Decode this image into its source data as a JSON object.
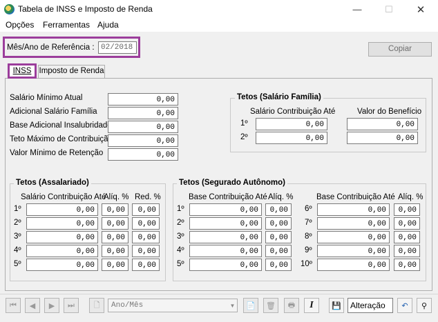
{
  "window": {
    "title": "Tabela de INSS e Imposto de Renda"
  },
  "menu": [
    "Opções",
    "Ferramentas",
    "Ajuda"
  ],
  "reference": {
    "label": "Mês/Ano de Referência :",
    "value": "02/2018"
  },
  "copy_button": "Copiar",
  "tabs": [
    "INSS",
    "Imposto de Renda"
  ],
  "general": {
    "rows": [
      {
        "label": "Salário Mínimo Atual",
        "value": "0,00"
      },
      {
        "label": "Adicional Salário Família",
        "value": "0,00"
      },
      {
        "label": "Base Adicional Insalubridade",
        "value": "0,00"
      },
      {
        "label": "Teto Máximo de Contribuição",
        "value": "0,00"
      },
      {
        "label": "Valor Mínimo de Retenção",
        "value": "0,00"
      }
    ]
  },
  "salario_familia": {
    "title": "Tetos (Salário Família)",
    "col1": "Salário Contribuição Até",
    "col2": "Valor do Benefício",
    "rows": [
      {
        "n": "1º",
        "ate": "0,00",
        "valor": "0,00"
      },
      {
        "n": "2º",
        "ate": "0,00",
        "valor": "0,00"
      }
    ]
  },
  "assalariado": {
    "title": "Tetos (Assalariado)",
    "col1": "Salário Contribuição Até",
    "col2": "Alíq. %",
    "col3": "Red. %",
    "rows": [
      {
        "n": "1º",
        "ate": "0,00",
        "aliq": "0,00",
        "red": "0,00"
      },
      {
        "n": "2º",
        "ate": "0,00",
        "aliq": "0,00",
        "red": "0,00"
      },
      {
        "n": "3º",
        "ate": "0,00",
        "aliq": "0,00",
        "red": "0,00"
      },
      {
        "n": "4º",
        "ate": "0,00",
        "aliq": "0,00",
        "red": "0,00"
      },
      {
        "n": "5º",
        "ate": "0,00",
        "aliq": "0,00",
        "red": "0,00"
      }
    ]
  },
  "autonomo": {
    "title": "Tetos (Segurado Autônomo)",
    "col1": "Base Contribuição Até",
    "col2": "Alíq. %",
    "left_rows": [
      {
        "n": "1º",
        "ate": "0,00",
        "aliq": "0,00"
      },
      {
        "n": "2º",
        "ate": "0,00",
        "aliq": "0,00"
      },
      {
        "n": "3º",
        "ate": "0,00",
        "aliq": "0,00"
      },
      {
        "n": "4º",
        "ate": "0,00",
        "aliq": "0,00"
      },
      {
        "n": "5º",
        "ate": "0,00",
        "aliq": "0,00"
      }
    ],
    "right_rows": [
      {
        "n": "6º",
        "ate": "0,00",
        "aliq": "0,00"
      },
      {
        "n": "7º",
        "ate": "0,00",
        "aliq": "0,00"
      },
      {
        "n": "8º",
        "ate": "0,00",
        "aliq": "0,00"
      },
      {
        "n": "9º",
        "ate": "0,00",
        "aliq": "0,00"
      },
      {
        "n": "10º",
        "ate": "0,00",
        "aliq": "0,00"
      }
    ]
  },
  "toolbar": {
    "combo_value": "Ano/Mês",
    "status": "Alteração",
    "icons": [
      "first-icon",
      "prev-icon",
      "next-icon",
      "last-icon",
      "new-doc-icon",
      "combo-arrow-icon",
      "copy-doc-icon",
      "delete-icon",
      "print-icon",
      "italic-i-icon",
      "save-icon",
      "undo-icon",
      "binoculars-icon"
    ]
  }
}
